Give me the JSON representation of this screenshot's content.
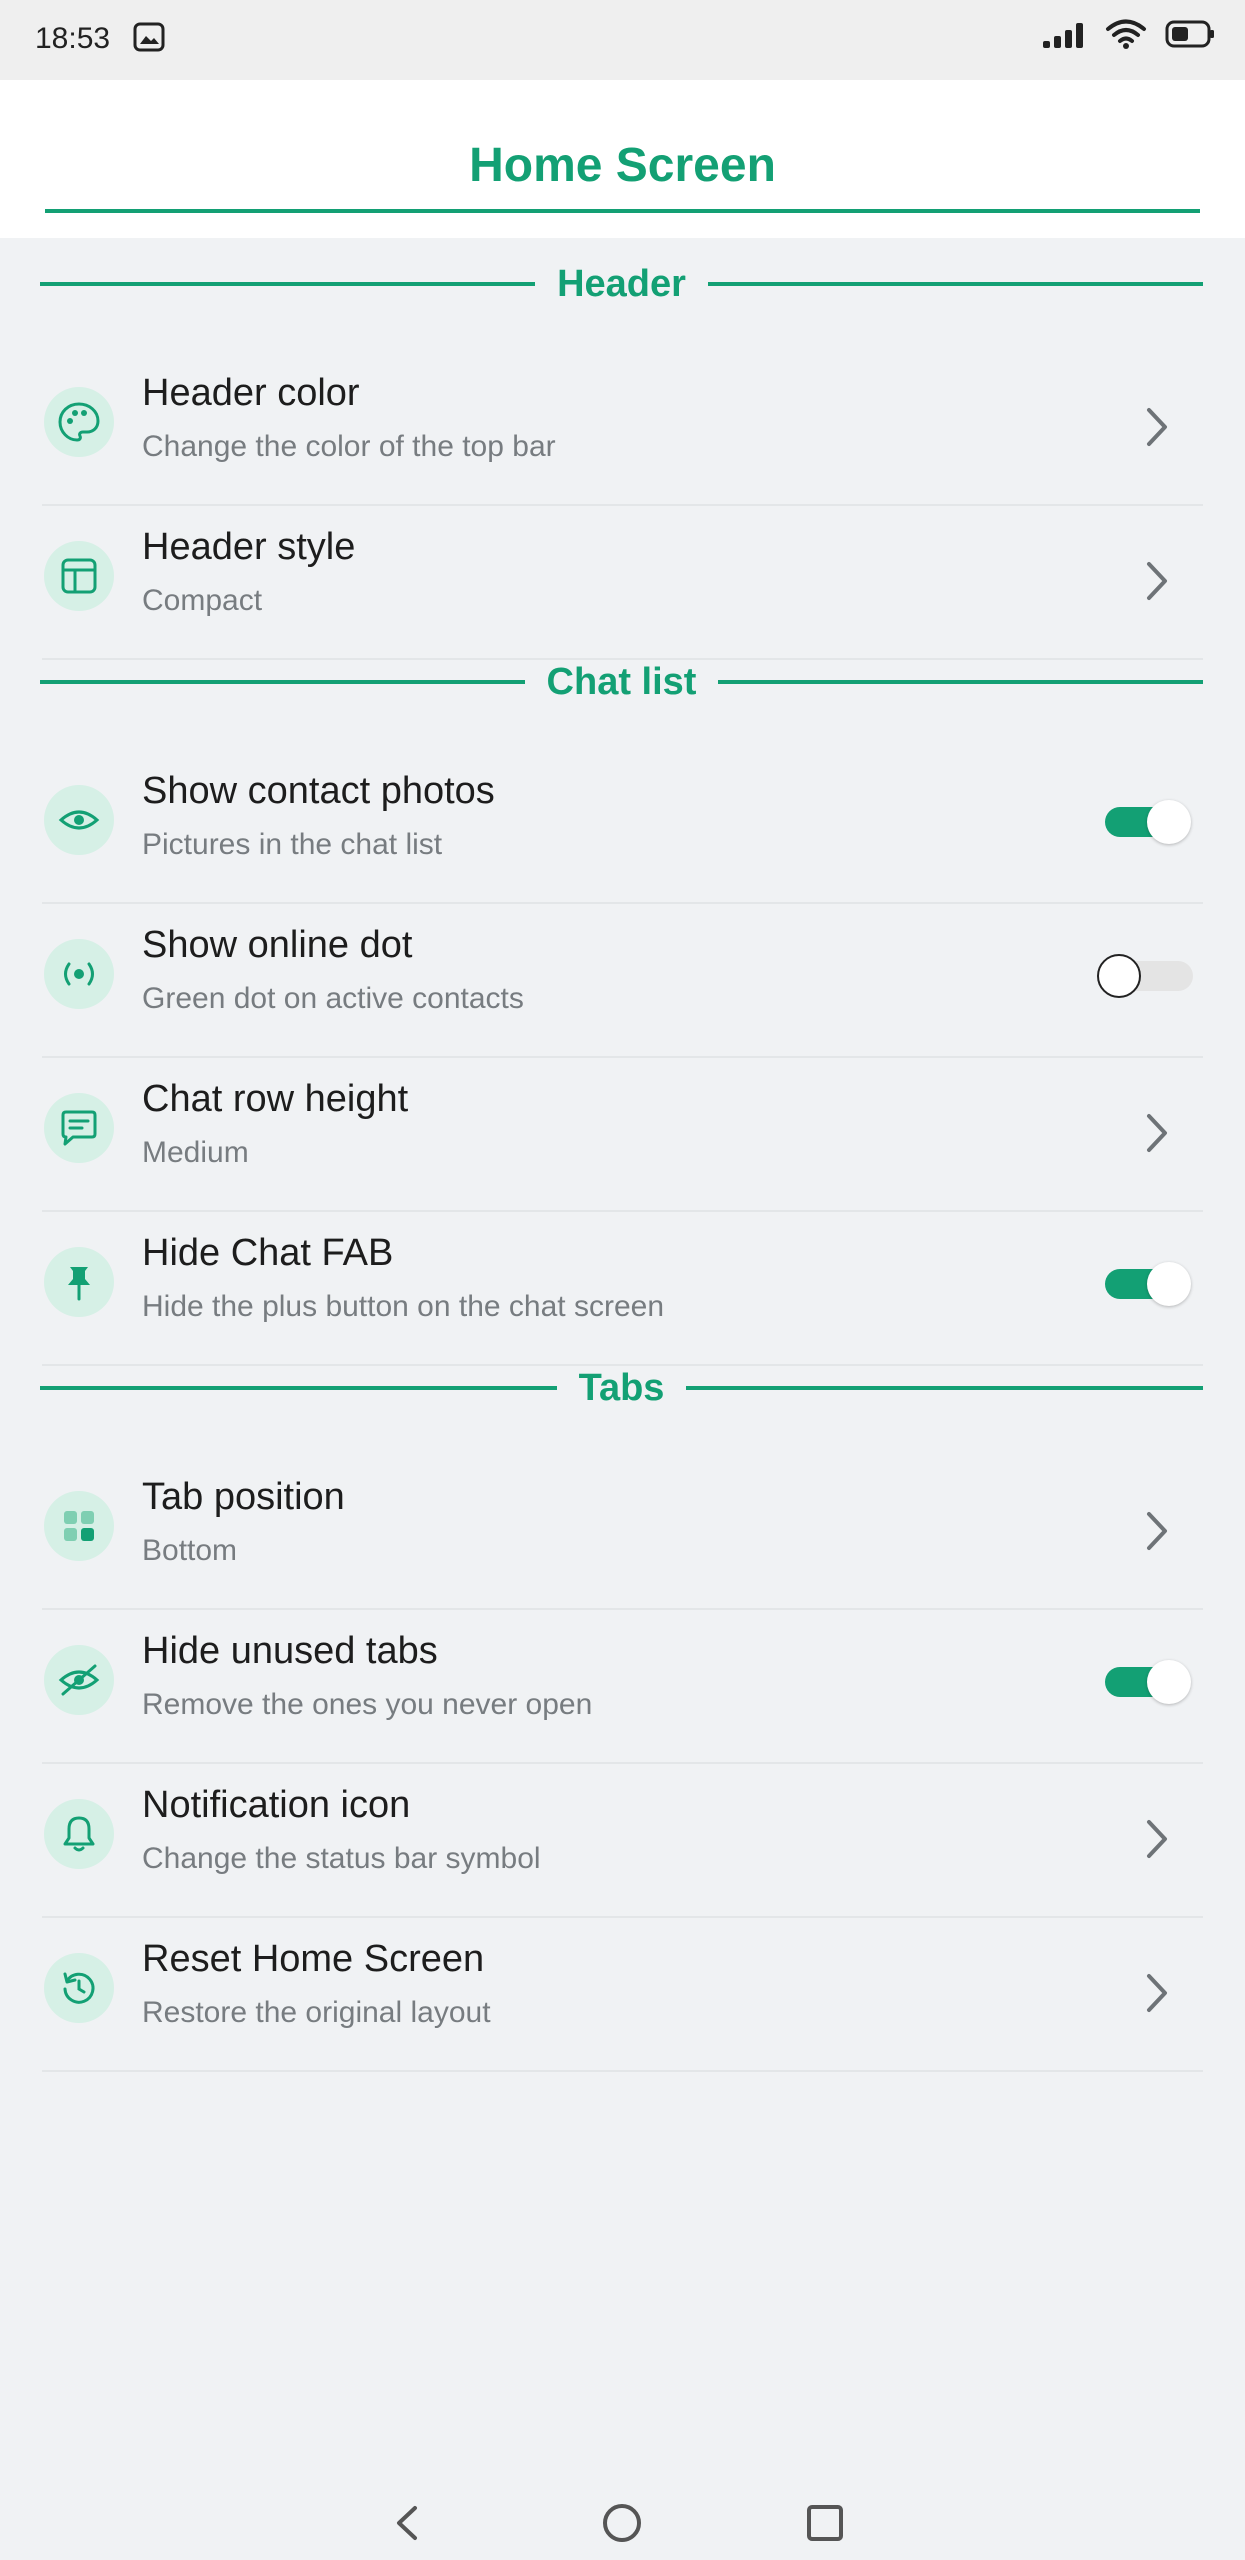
{
  "status_bar": {
    "time": "18:53",
    "icons": [
      "gallery-icon",
      "signal-icon",
      "wifi-icon",
      "battery-icon"
    ]
  },
  "header": {
    "title": "Home Screen"
  },
  "sections": {
    "header": {
      "label": "Header",
      "items": [
        {
          "title": "Header color",
          "subtitle": "Change the color of the top bar",
          "icon": "palette-icon",
          "control": "chevron"
        },
        {
          "title": "Header style",
          "subtitle": "Compact",
          "icon": "layout-icon",
          "control": "chevron"
        }
      ]
    },
    "chat_list": {
      "label": "Chat list",
      "items": [
        {
          "title": "Show contact photos",
          "subtitle": "Pictures in the chat list",
          "icon": "eye-icon",
          "control": "toggle",
          "enabled": true
        },
        {
          "title": "Show online dot",
          "subtitle": "Green dot on active contacts",
          "icon": "radio-dot-icon",
          "control": "toggle",
          "enabled": false
        },
        {
          "title": "Chat row height",
          "subtitle": "Medium",
          "icon": "chat-bubble-icon",
          "control": "chevron"
        },
        {
          "title": "Hide Chat FAB",
          "subtitle": "Hide the plus button on the chat screen",
          "icon": "pin-icon",
          "control": "toggle",
          "enabled": true
        }
      ]
    },
    "tabs": {
      "label": "Tabs",
      "items": [
        {
          "title": "Tab position",
          "subtitle": "Bottom",
          "icon": "grid-icon",
          "control": "chevron"
        },
        {
          "title": "Hide unused tabs",
          "subtitle": "Remove the ones you never open",
          "icon": "eye-off-icon",
          "control": "toggle",
          "enabled": true
        },
        {
          "title": "Notification icon",
          "subtitle": "Change the status bar symbol",
          "icon": "bell-icon",
          "control": "chevron"
        },
        {
          "title": "Reset Home Screen",
          "subtitle": "Restore the original layout",
          "icon": "reset-icon",
          "control": "chevron"
        }
      ]
    }
  },
  "colors": {
    "accent": "#13a074",
    "icon_bg": "#d6f0e6",
    "background": "#f0f2f4"
  },
  "nav_bar": [
    "back-icon",
    "home-icon",
    "recents-icon"
  ]
}
